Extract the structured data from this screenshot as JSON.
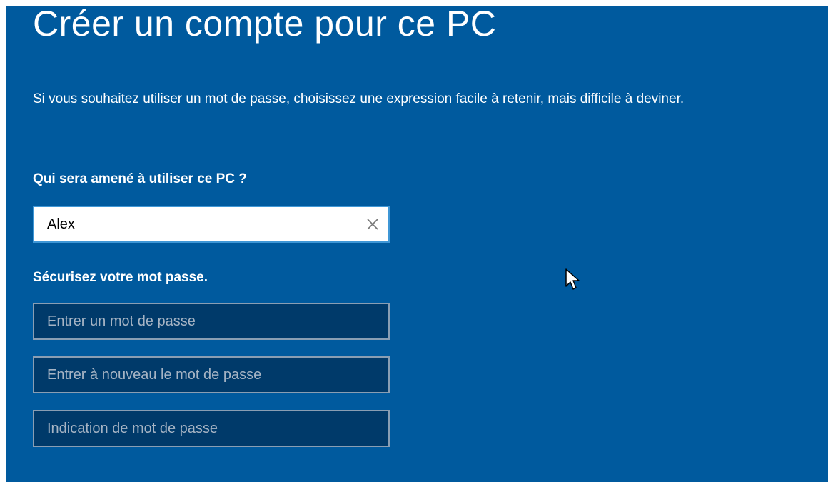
{
  "page": {
    "title": "Créer un compte pour ce PC",
    "description": "Si vous souhaitez utiliser un mot de passe, choisissez une expression facile à retenir, mais difficile à deviner.",
    "who_label": "Qui sera amené à utiliser ce PC ?",
    "secure_label": "Sécurisez votre mot passe."
  },
  "fields": {
    "username": {
      "value": "Alex",
      "clear_icon": "close-icon"
    },
    "password": {
      "placeholder": "Entrer un mot de passe"
    },
    "password_confirm": {
      "placeholder": "Entrer à nouveau le mot de passe"
    },
    "password_hint": {
      "placeholder": "Indication de mot de passe"
    }
  },
  "colors": {
    "background": "#005a9e",
    "input_dark": "#003a6a",
    "input_focus_border": "#3f97d6"
  },
  "icons": {
    "pointer": "mouse-pointer-icon"
  }
}
